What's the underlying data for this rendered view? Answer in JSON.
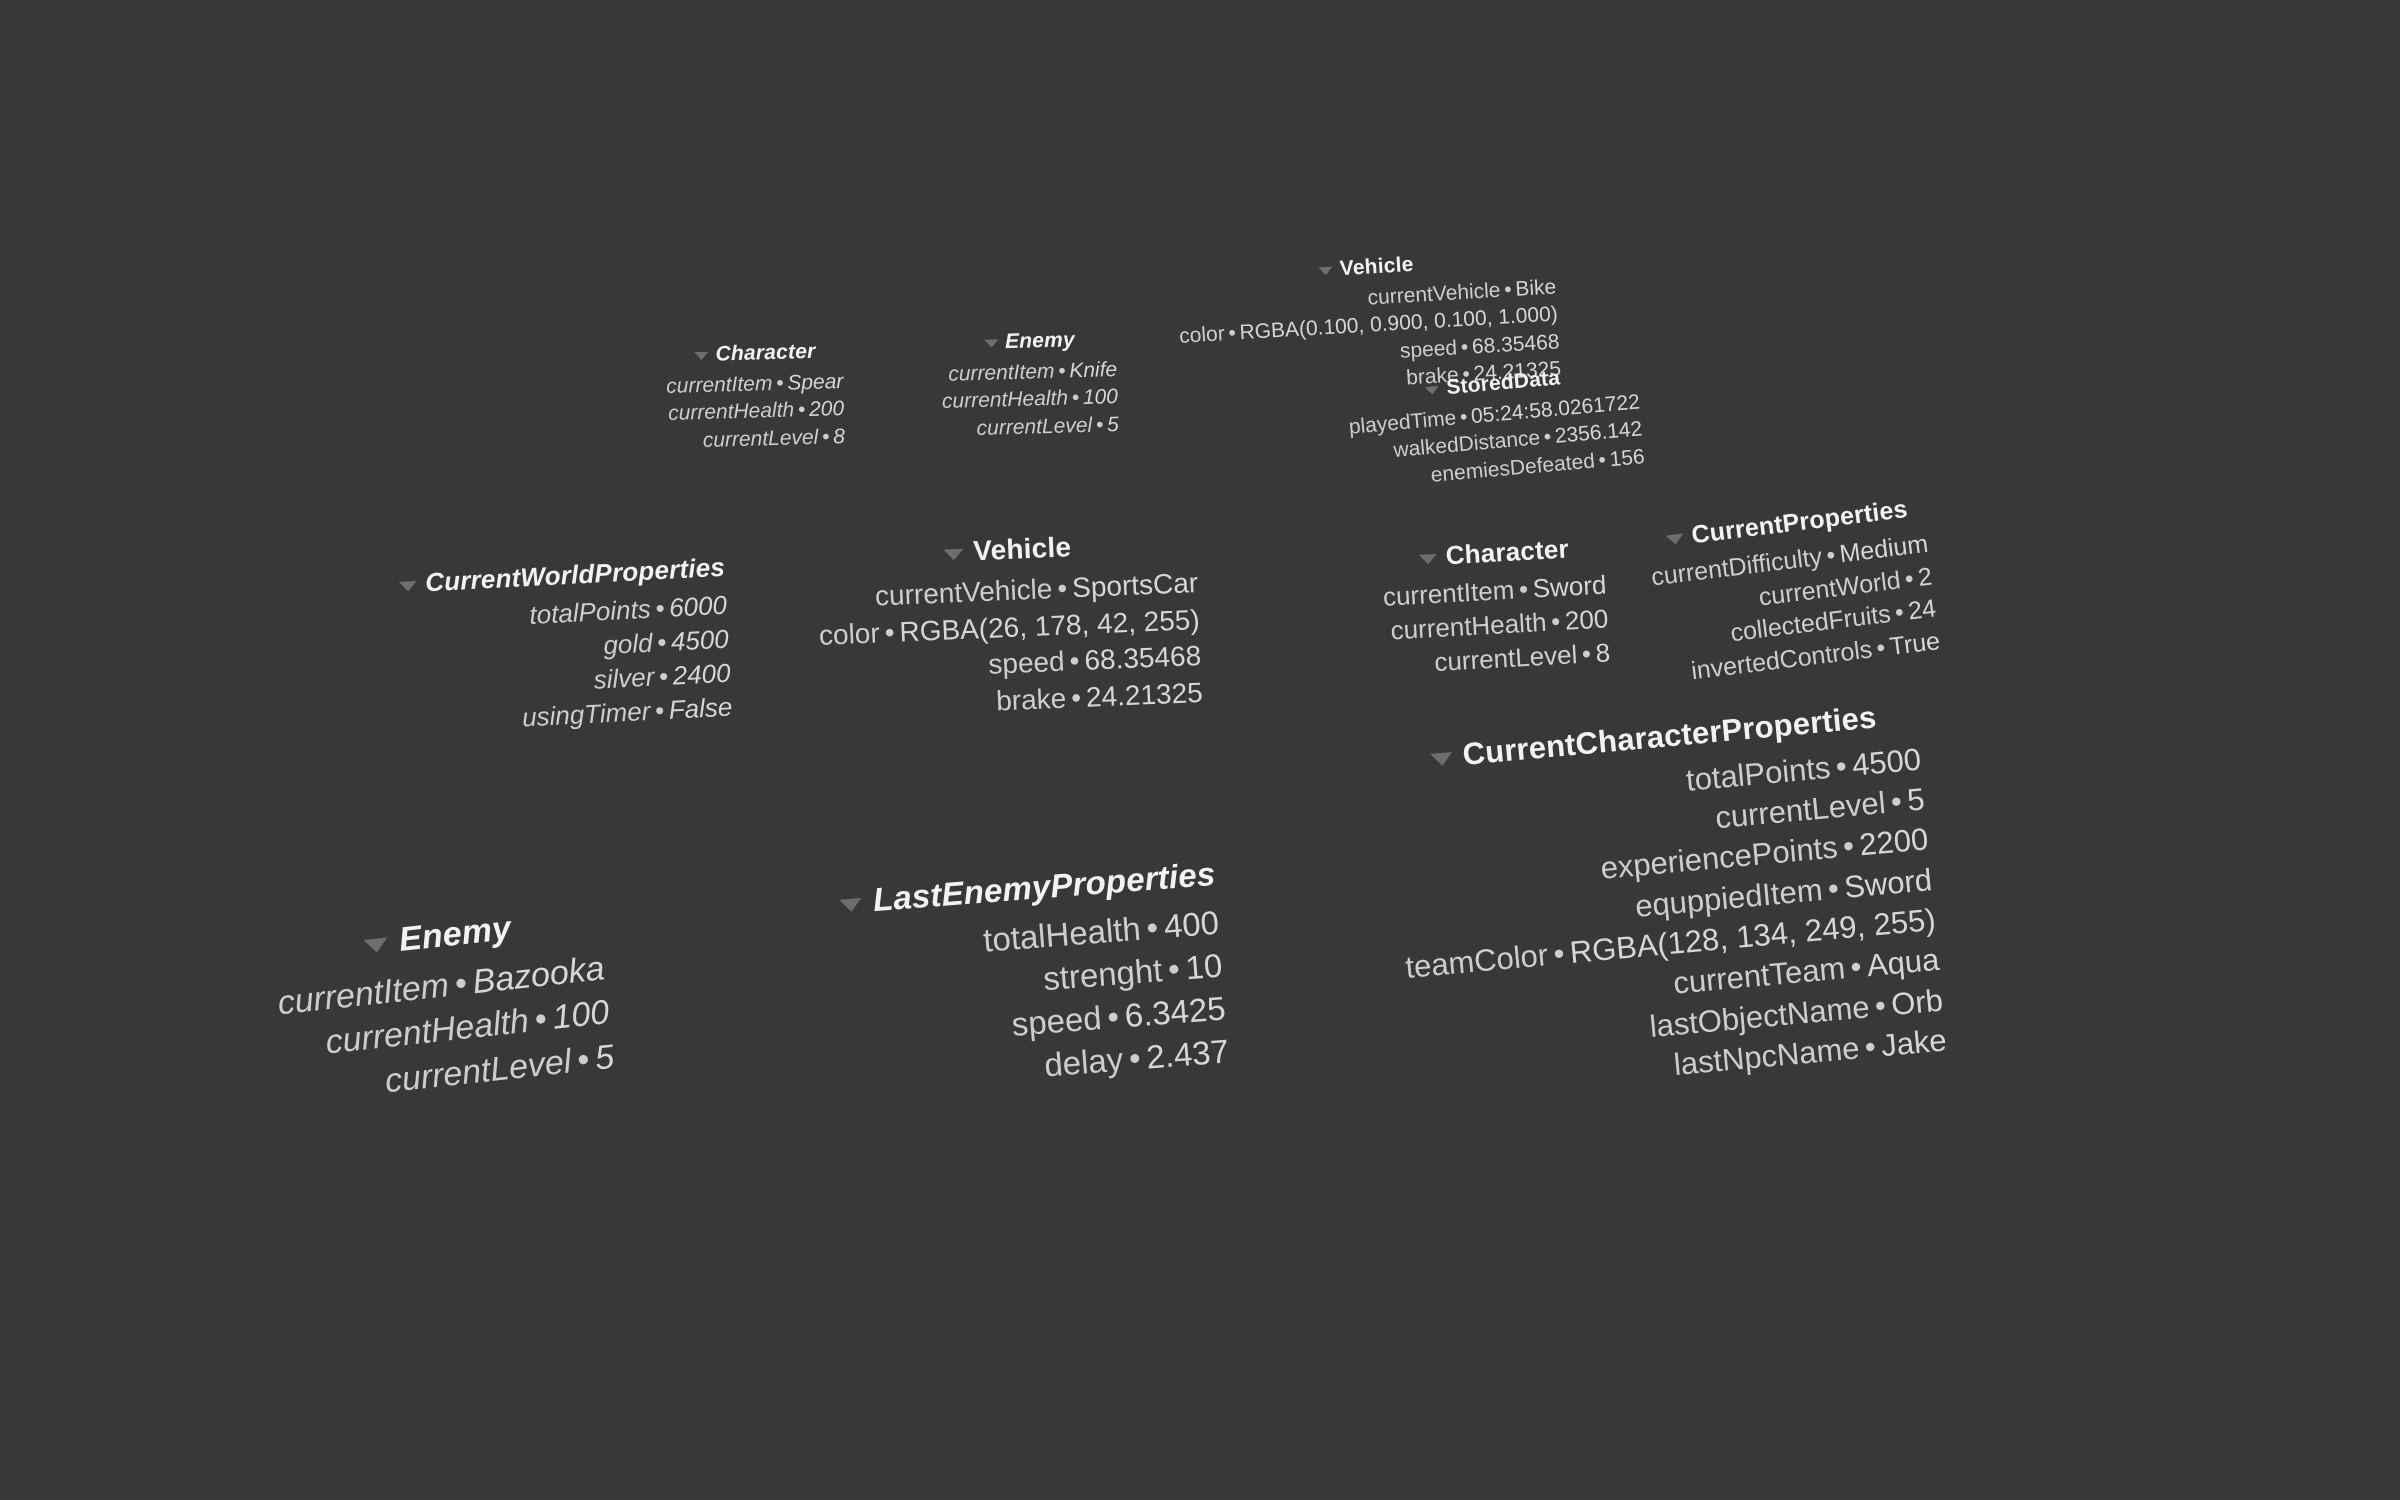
{
  "scene": {
    "background_color": "#383838",
    "text_color": "#cdcdcd",
    "header_color": "#f2f2f2",
    "foldout_arrow_color": "#6e6e6e",
    "separator": "•"
  },
  "panels": [
    {
      "id": "character-top",
      "title": "Character",
      "rows": [
        {
          "label": "currentItem",
          "value": "Spear"
        },
        {
          "label": "currentHealth",
          "value": "200"
        },
        {
          "label": "currentLevel",
          "value": "8"
        }
      ]
    },
    {
      "id": "enemy-top",
      "title": "Enemy",
      "rows": [
        {
          "label": "currentItem",
          "value": "Knife"
        },
        {
          "label": "currentHealth",
          "value": "100"
        },
        {
          "label": "currentLevel",
          "value": "5"
        }
      ]
    },
    {
      "id": "vehicle-bike",
      "title": "Vehicle",
      "rows": [
        {
          "label": "currentVehicle",
          "value": "Bike"
        },
        {
          "label": "color",
          "value": "RGBA(0.100, 0.900, 0.100, 1.000)"
        },
        {
          "label": "speed",
          "value": "68.35468"
        },
        {
          "label": "brake",
          "value": "24.21325"
        }
      ]
    },
    {
      "id": "storeddata",
      "title": "StoredData",
      "rows": [
        {
          "label": "playedTime",
          "value": "05:24:58.0261722"
        },
        {
          "label": "walkedDistance",
          "value": "2356.142"
        },
        {
          "label": "enemiesDefeated",
          "value": "156"
        }
      ]
    },
    {
      "id": "worldprops",
      "title": "CurrentWorldProperties",
      "rows": [
        {
          "label": "totalPoints",
          "value": "6000"
        },
        {
          "label": "gold",
          "value": "4500"
        },
        {
          "label": "silver",
          "value": "2400"
        },
        {
          "label": "usingTimer",
          "value": "False"
        }
      ]
    },
    {
      "id": "vehicle-sports",
      "title": "Vehicle",
      "rows": [
        {
          "label": "currentVehicle",
          "value": "SportsCar"
        },
        {
          "label": "color",
          "value": "RGBA(26, 178, 42, 255)"
        },
        {
          "label": "speed",
          "value": "68.35468"
        },
        {
          "label": "brake",
          "value": "24.21325"
        }
      ]
    },
    {
      "id": "character-right",
      "title": "Character",
      "rows": [
        {
          "label": "currentItem",
          "value": "Sword"
        },
        {
          "label": "currentHealth",
          "value": "200"
        },
        {
          "label": "currentLevel",
          "value": "8"
        }
      ]
    },
    {
      "id": "currentprops",
      "title": "CurrentProperties",
      "rows": [
        {
          "label": "currentDifficulty",
          "value": "Medium"
        },
        {
          "label": "currentWorld",
          "value": "2"
        },
        {
          "label": "collectedFruits",
          "value": "24"
        },
        {
          "label": "invertedControls",
          "value": "True"
        }
      ]
    },
    {
      "id": "charprops",
      "title": "CurrentCharacterProperties",
      "rows": [
        {
          "label": "totalPoints",
          "value": "4500"
        },
        {
          "label": "currentLevel",
          "value": "5"
        },
        {
          "label": "experiencePoints",
          "value": "2200"
        },
        {
          "label": "equppiedItem",
          "value": "Sword"
        },
        {
          "label": "teamColor",
          "value": "RGBA(128, 134, 249, 255)"
        },
        {
          "label": "currentTeam",
          "value": "Aqua"
        },
        {
          "label": "lastObjectName",
          "value": "Orb"
        },
        {
          "label": "lastNpcName",
          "value": "Jake"
        }
      ]
    },
    {
      "id": "enemy-bottom",
      "title": "Enemy",
      "rows": [
        {
          "label": "currentItem",
          "value": "Bazooka"
        },
        {
          "label": "currentHealth",
          "value": "100"
        },
        {
          "label": "currentLevel",
          "value": "5"
        }
      ]
    },
    {
      "id": "lastenemy",
      "title": "LastEnemyProperties",
      "rows": [
        {
          "label": "totalHealth",
          "value": "400"
        },
        {
          "label": "strenght",
          "value": "10"
        },
        {
          "label": "speed",
          "value": "6.3425"
        },
        {
          "label": "delay",
          "value": "2.437"
        }
      ]
    }
  ]
}
